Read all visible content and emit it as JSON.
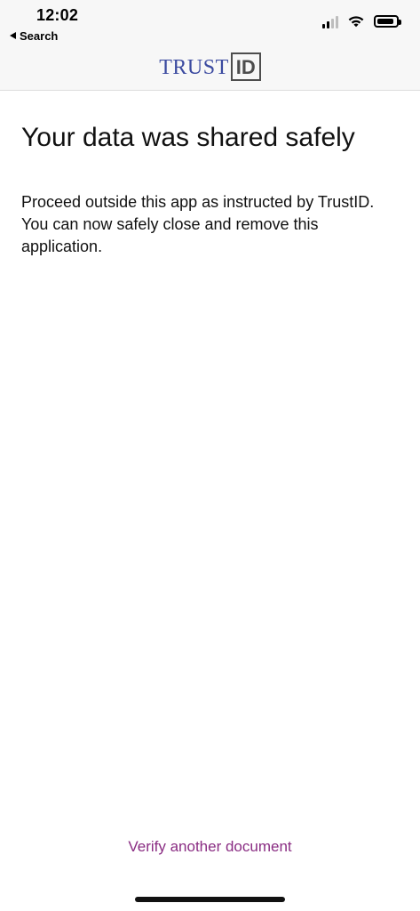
{
  "status_bar": {
    "time": "12:02",
    "back_label": "Search",
    "battery_level": 0.9
  },
  "header": {
    "logo_left": "TRUST",
    "logo_right": "ID"
  },
  "main": {
    "title": "Your data was shared safely",
    "message": "Proceed outside this app as instructed by TrustID. You can now safely close and remove this application."
  },
  "actions": {
    "verify_another": "Verify another document"
  },
  "colors": {
    "brand_blue": "#3b4aa0",
    "brand_gray": "#4d4d4d",
    "link_purple": "#8a2d83",
    "header_bg": "#f7f7f7"
  },
  "icons": {
    "back": "back-arrow-icon",
    "signal": "cellular-signal-icon",
    "wifi": "wifi-icon",
    "battery": "battery-icon"
  }
}
